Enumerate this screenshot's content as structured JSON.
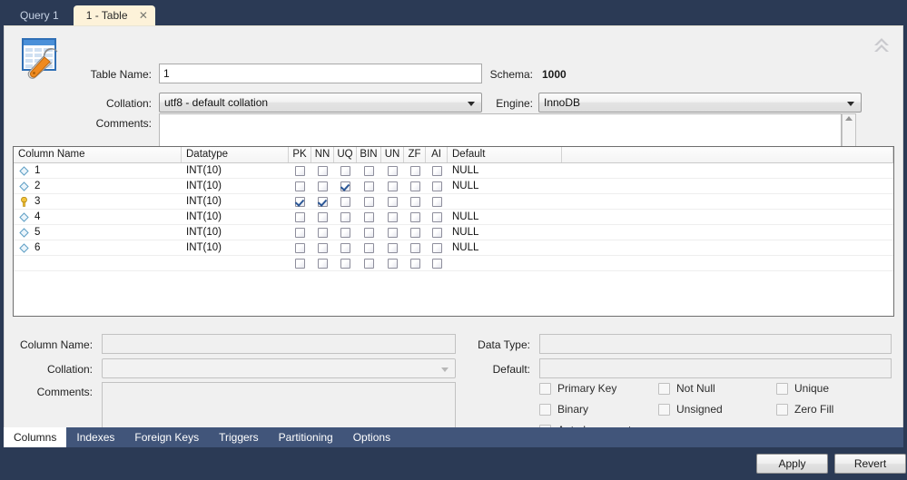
{
  "editor_tabs": [
    {
      "label": "Query 1",
      "active": false,
      "closable": false
    },
    {
      "label": "1 - Table",
      "active": true,
      "closable": true,
      "close_glyph": "✕"
    }
  ],
  "header": {
    "icon_name": "table-editor-icon",
    "table_name_label": "Table Name:",
    "table_name_value": "1",
    "collation_label": "Collation:",
    "collation_value": "utf8 - default collation",
    "comments_label": "Comments:",
    "comments_value": "",
    "schema_label": "Schema:",
    "schema_value": "1000",
    "engine_label": "Engine:",
    "engine_value": "InnoDB",
    "collapse_title": "collapse"
  },
  "grid": {
    "headers": [
      "Column Name",
      "Datatype",
      "PK",
      "NN",
      "UQ",
      "BIN",
      "UN",
      "ZF",
      "AI",
      "Default",
      ""
    ],
    "rows": [
      {
        "icon": "diamond",
        "name": "1",
        "datatype": "INT(10)",
        "pk": false,
        "nn": false,
        "uq": false,
        "bin": false,
        "un": false,
        "zf": false,
        "ai": false,
        "default": "NULL"
      },
      {
        "icon": "diamond",
        "name": "2",
        "datatype": "INT(10)",
        "pk": false,
        "nn": false,
        "uq": true,
        "bin": false,
        "un": false,
        "zf": false,
        "ai": false,
        "default": "NULL"
      },
      {
        "icon": "key",
        "name": "3",
        "datatype": "INT(10)",
        "pk": true,
        "nn": true,
        "uq": false,
        "bin": false,
        "un": false,
        "zf": false,
        "ai": false,
        "default": ""
      },
      {
        "icon": "diamond",
        "name": "4",
        "datatype": "INT(10)",
        "pk": false,
        "nn": false,
        "uq": false,
        "bin": false,
        "un": false,
        "zf": false,
        "ai": false,
        "default": "NULL"
      },
      {
        "icon": "diamond",
        "name": "5",
        "datatype": "INT(10)",
        "pk": false,
        "nn": false,
        "uq": false,
        "bin": false,
        "un": false,
        "zf": false,
        "ai": false,
        "default": "NULL"
      },
      {
        "icon": "diamond",
        "name": "6",
        "datatype": "INT(10)",
        "pk": false,
        "nn": false,
        "uq": false,
        "bin": false,
        "un": false,
        "zf": false,
        "ai": false,
        "default": "NULL"
      },
      {
        "icon": "none",
        "name": "",
        "datatype": "",
        "pk": false,
        "nn": false,
        "uq": false,
        "bin": false,
        "un": false,
        "zf": false,
        "ai": false,
        "default": ""
      }
    ]
  },
  "detail": {
    "column_name_label": "Column Name:",
    "column_name_value": "",
    "collation_label": "Collation:",
    "collation_value": "",
    "comments_label": "Comments:",
    "comments_value": "",
    "data_type_label": "Data Type:",
    "data_type_value": "",
    "default_label": "Default:",
    "default_value": "",
    "flags": [
      {
        "label": "Primary Key",
        "checked": false
      },
      {
        "label": "Not Null",
        "checked": false
      },
      {
        "label": "Unique",
        "checked": false
      },
      {
        "label": "Binary",
        "checked": false
      },
      {
        "label": "Unsigned",
        "checked": false
      },
      {
        "label": "Zero Fill",
        "checked": false
      },
      {
        "label": "Auto Increment",
        "checked": false
      }
    ]
  },
  "bottom_tabs": [
    {
      "label": "Columns",
      "active": true
    },
    {
      "label": "Indexes",
      "active": false
    },
    {
      "label": "Foreign Keys",
      "active": false
    },
    {
      "label": "Triggers",
      "active": false
    },
    {
      "label": "Partitioning",
      "active": false
    },
    {
      "label": "Options",
      "active": false
    }
  ],
  "footer": {
    "apply_label": "Apply",
    "revert_label": "Revert"
  },
  "colors": {
    "window_chrome": "#2b3a55",
    "active_tab_bg": "#fdf2d9",
    "bottom_tab_bar": "#41557a",
    "panel_bg": "#f0f0f0",
    "check_blue": "#2b5796",
    "key_yellow": "#e8b93a"
  }
}
